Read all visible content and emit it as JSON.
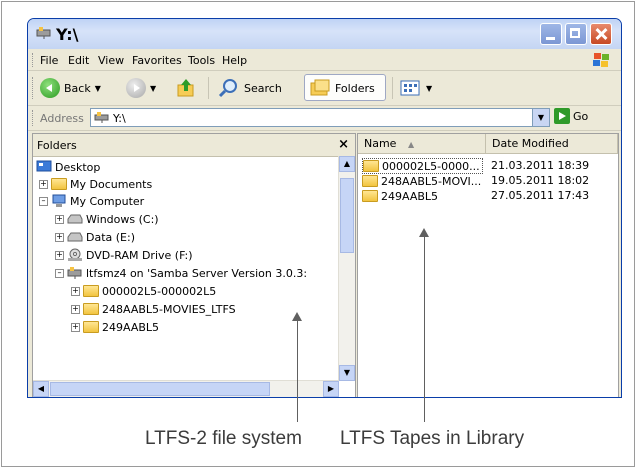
{
  "window": {
    "title": "Y:\\",
    "menu": [
      "File",
      "Edit",
      "View",
      "Favorites",
      "Tools",
      "Help"
    ],
    "toolbar": {
      "back_label": "Back",
      "search_label": "Search",
      "folders_label": "Folders"
    },
    "address": {
      "label": "Address",
      "value": "Y:\\",
      "go_label": "Go"
    }
  },
  "folders_pane": {
    "title": "Folders",
    "tree": [
      {
        "label": "Desktop"
      },
      {
        "label": "My Documents"
      },
      {
        "label": "My Computer"
      },
      {
        "label": "Windows (C:)"
      },
      {
        "label": "Data (E:)"
      },
      {
        "label": "DVD-RAM Drive (F:)"
      },
      {
        "label": "ltfsmz4 on 'Samba Server Version 3.0.3:"
      },
      {
        "label": "000002L5-000002L5"
      },
      {
        "label": "248AABL5-MOVIES_LTFS"
      },
      {
        "label": "249AABL5"
      }
    ]
  },
  "files_pane": {
    "columns": [
      "Name",
      "Date Modified"
    ],
    "rows": [
      {
        "name": "000002L5-0000...",
        "date": "21.03.2011 18:39"
      },
      {
        "name": "248AABL5-MOVI...",
        "date": "19.05.2011 18:02"
      },
      {
        "name": "249AABL5",
        "date": "27.05.2011 17:43"
      }
    ]
  },
  "callouts": {
    "left": "LTFS-2 file system",
    "right": "LTFS Tapes in Library"
  }
}
